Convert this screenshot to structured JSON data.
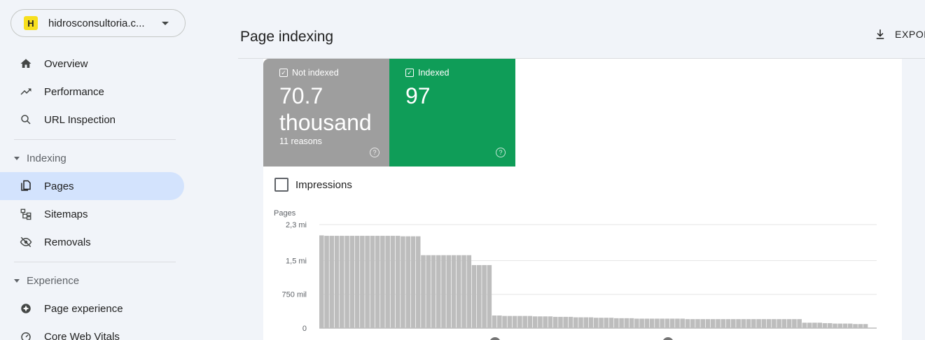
{
  "property": {
    "name": "hidrosconsultoria.c...",
    "logo_letter": "H"
  },
  "nav": {
    "overview": "Overview",
    "performance": "Performance",
    "url_inspection": "URL Inspection",
    "indexing_section": "Indexing",
    "pages": "Pages",
    "sitemaps": "Sitemaps",
    "removals": "Removals",
    "experience_section": "Experience",
    "page_experience": "Page experience",
    "core_web_vitals": "Core Web Vitals"
  },
  "header": {
    "title": "Page indexing",
    "export_label": "EXPOR"
  },
  "tiles": {
    "not_indexed": {
      "label": "Not indexed",
      "value": "70.7 thousand",
      "sub": "11 reasons",
      "color": "#9e9e9e"
    },
    "indexed": {
      "label": "Indexed",
      "value": "97",
      "color": "#0f9d58"
    }
  },
  "impressions_label": "Impressions",
  "chart_data": {
    "type": "bar",
    "ylabel": "Pages",
    "yticks": [
      "0",
      "750 mil",
      "1,5 mi",
      "2,3 mi"
    ],
    "ytick_values": [
      0,
      750000,
      1500000,
      2300000
    ],
    "ylim": [
      0,
      2300000
    ],
    "bar_color": "#bdbdbd",
    "values": [
      2060000,
      2050000,
      2050000,
      2050000,
      2050000,
      2050000,
      2050000,
      2050000,
      2050000,
      2050000,
      2050000,
      2050000,
      2050000,
      2050000,
      2050000,
      2050000,
      2040000,
      2040000,
      2040000,
      2040000,
      1620000,
      1620000,
      1620000,
      1620000,
      1620000,
      1620000,
      1620000,
      1620000,
      1620000,
      1620000,
      1400000,
      1400000,
      1400000,
      1400000,
      280000,
      280000,
      270000,
      270000,
      270000,
      270000,
      270000,
      270000,
      260000,
      260000,
      260000,
      260000,
      250000,
      250000,
      250000,
      250000,
      240000,
      240000,
      240000,
      240000,
      230000,
      230000,
      230000,
      230000,
      220000,
      220000,
      220000,
      220000,
      210000,
      210000,
      210000,
      210000,
      210000,
      210000,
      210000,
      210000,
      210000,
      210000,
      200000,
      200000,
      200000,
      200000,
      200000,
      200000,
      200000,
      200000,
      200000,
      200000,
      200000,
      200000,
      200000,
      200000,
      200000,
      200000,
      200000,
      200000,
      200000,
      200000,
      200000,
      200000,
      200000,
      120000,
      120000,
      120000,
      120000,
      110000,
      110000,
      100000,
      100000,
      100000,
      100000,
      90000,
      90000,
      90000
    ],
    "annotations": [
      "1",
      "1"
    ]
  }
}
